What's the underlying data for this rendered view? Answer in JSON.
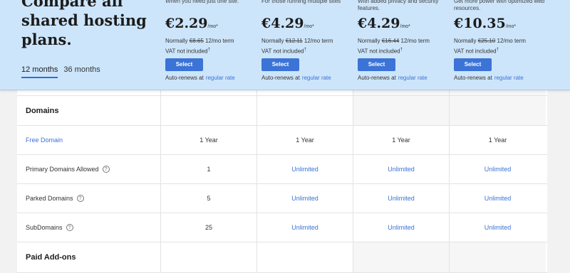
{
  "header": {
    "headline": "Compare all shared hosting plans.",
    "term_tabs": [
      {
        "label": "12 months",
        "active": true
      },
      {
        "label": "36 months",
        "active": false
      }
    ]
  },
  "plans": [
    {
      "desc": "When you need just one site.",
      "price": "€2.29",
      "unit": "/mo*",
      "normally_label": "Normally",
      "normally_price": "€8.65",
      "term": "12/mo term",
      "vat": "VAT not included",
      "vat_mark": "†",
      "select": "Select",
      "renew": "Auto-renews at",
      "renew_link": "regular rate"
    },
    {
      "desc": "For those running multiple sites",
      "price": "€4.29",
      "unit": "/mo*",
      "normally_label": "Normally",
      "normally_price": "€12.11",
      "term": "12/mo term",
      "vat": "VAT not included",
      "vat_mark": "†",
      "select": "Select",
      "renew": "Auto-renews at",
      "renew_link": "regular rate"
    },
    {
      "desc": "With added privacy and security features.",
      "price": "€4.29",
      "unit": "/mo*",
      "normally_label": "Normally",
      "normally_price": "€16.44",
      "term": "12/mo term",
      "vat": "VAT not included",
      "vat_mark": "†",
      "select": "Select",
      "renew": "Auto-renews at",
      "renew_link": "regular rate"
    },
    {
      "desc": "Get more power with optimized web resources.",
      "price": "€10.35",
      "unit": "/mo*",
      "normally_label": "Normally",
      "normally_price": "€25.10",
      "term": "12/mo term",
      "vat": "VAT not included",
      "vat_mark": "†",
      "select": "Select",
      "renew": "Auto-renews at",
      "renew_link": "regular rate"
    }
  ],
  "table": {
    "domains_heading": "Domains",
    "free_domain": {
      "label": "Free Domain",
      "values": [
        "1 Year",
        "1 Year",
        "1 Year",
        "1 Year"
      ]
    },
    "primary_domains": {
      "label": "Primary Domains Allowed",
      "values": [
        "1",
        "Unlimited",
        "Unlimited",
        "Unlimited"
      ]
    },
    "parked_domains": {
      "label": "Parked Domains",
      "values": [
        "5",
        "Unlimited",
        "Unlimited",
        "Unlimited"
      ]
    },
    "subdomains": {
      "label": "SubDomains",
      "values": [
        "25",
        "Unlimited",
        "Unlimited",
        "Unlimited"
      ]
    },
    "paid_addons_heading": "Paid Add-ons",
    "help_icon_glyph": "?"
  },
  "colors": {
    "accent": "#3b73d6",
    "header_bg": "#cde5fb"
  }
}
